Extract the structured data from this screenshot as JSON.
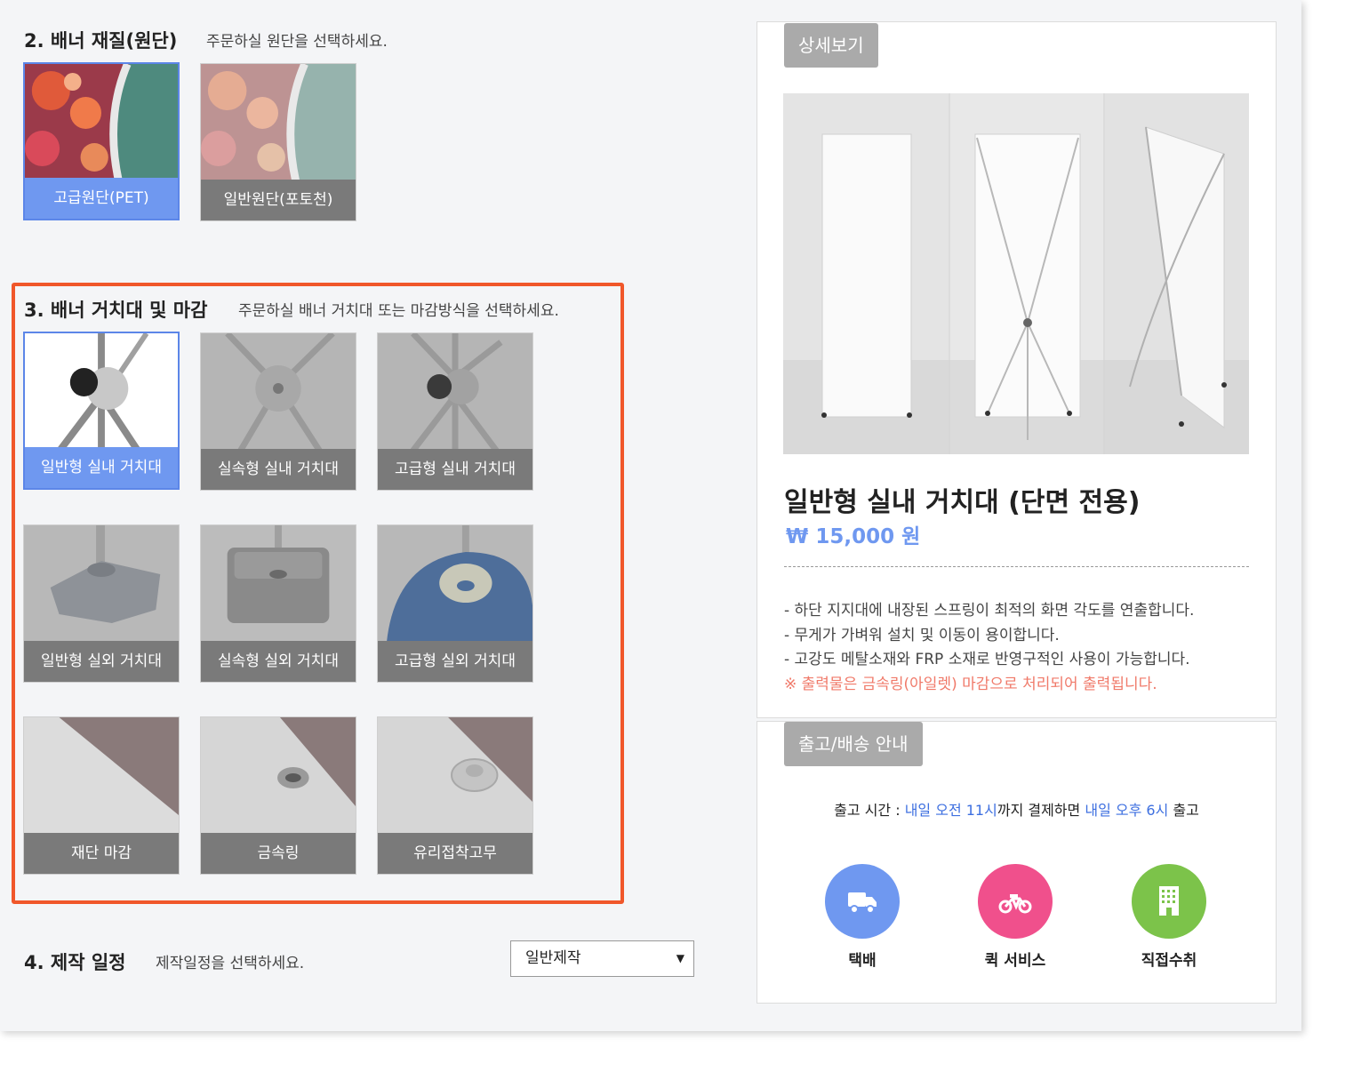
{
  "section2": {
    "title": "2. 배너 재질(원단)",
    "desc": "주문하실 원단을 선택하세요.",
    "options": [
      {
        "label": "고급원단(PET)",
        "selected": true
      },
      {
        "label": "일반원단(포토천)",
        "selected": false
      }
    ]
  },
  "section3": {
    "title": "3. 배너 거치대 및 마감",
    "desc": "주문하실 배너 거치대 또는 마감방식을 선택하세요.",
    "options": [
      {
        "label": "일반형 실내 거치대",
        "selected": true
      },
      {
        "label": "실속형 실내 거치대",
        "selected": false
      },
      {
        "label": "고급형 실내 거치대",
        "selected": false
      },
      {
        "label": "일반형 실외 거치대",
        "selected": false
      },
      {
        "label": "실속형 실외 거치대",
        "selected": false
      },
      {
        "label": "고급형 실외 거치대",
        "selected": false
      },
      {
        "label": "재단 마감",
        "selected": false
      },
      {
        "label": "금속링",
        "selected": false
      },
      {
        "label": "유리접착고무",
        "selected": false
      }
    ]
  },
  "section4": {
    "title": "4. 제작 일정",
    "desc": "제작일정을 선택하세요.",
    "select_value": "일반제작"
  },
  "detail": {
    "tab_label": "상세보기",
    "product_title": "일반형 실내 거치대 (단면 전용)",
    "price": "₩ 15,000 원",
    "lines": [
      "- 하단 지지대에 내장된 스프링이 최적의 화면 각도를 연출합니다.",
      "- 무게가 가벼워 설치 및 이동이 용이합니다.",
      "- 고강도 메탈소재와 FRP 소재로 반영구적인 사용이 가능합니다."
    ],
    "warning": "※ 출력물은 금속링(아일렛) 마감으로 처리되어 출력됩니다."
  },
  "shipping": {
    "tab_label": "출고/배송 안내",
    "time_prefix": "출고 시간 : ",
    "time_deadline": "내일 오전 11시",
    "time_middle": "까지 결제하면 ",
    "time_release": "내일 오후 6시",
    "time_suffix": " 출고",
    "methods": [
      {
        "name": "택배",
        "icon": "truck-icon",
        "color": "#6f98f0"
      },
      {
        "name": "퀵 서비스",
        "icon": "motorcycle-icon",
        "color": "#f0508c"
      },
      {
        "name": "직접수취",
        "icon": "building-icon",
        "color": "#7cc34a"
      }
    ]
  }
}
